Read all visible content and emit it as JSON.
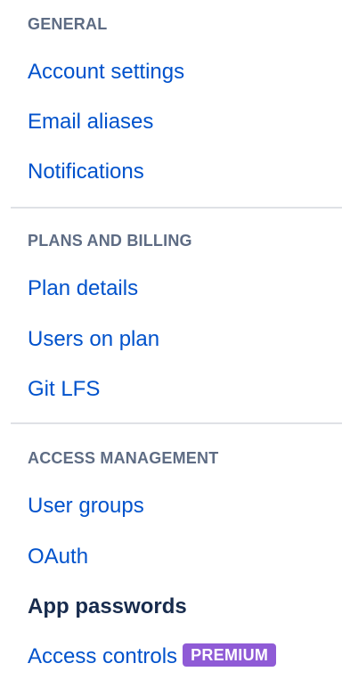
{
  "sections": [
    {
      "heading": "GENERAL",
      "items": [
        {
          "label": "Account settings"
        },
        {
          "label": "Email aliases"
        },
        {
          "label": "Notifications"
        }
      ]
    },
    {
      "heading": "PLANS AND BILLING",
      "items": [
        {
          "label": "Plan details"
        },
        {
          "label": "Users on plan"
        },
        {
          "label": "Git LFS"
        }
      ]
    },
    {
      "heading": "ACCESS MANAGEMENT",
      "items": [
        {
          "label": "User groups"
        },
        {
          "label": "OAuth"
        },
        {
          "label": "App passwords",
          "active": true
        },
        {
          "label": "Access controls",
          "badge": "PREMIUM"
        }
      ]
    }
  ],
  "colors": {
    "link": "#0052cc",
    "active_link": "#172b4d",
    "heading": "#5e6c84",
    "divider": "#dfe1e6",
    "premium_badge": "#8f5bd6"
  }
}
